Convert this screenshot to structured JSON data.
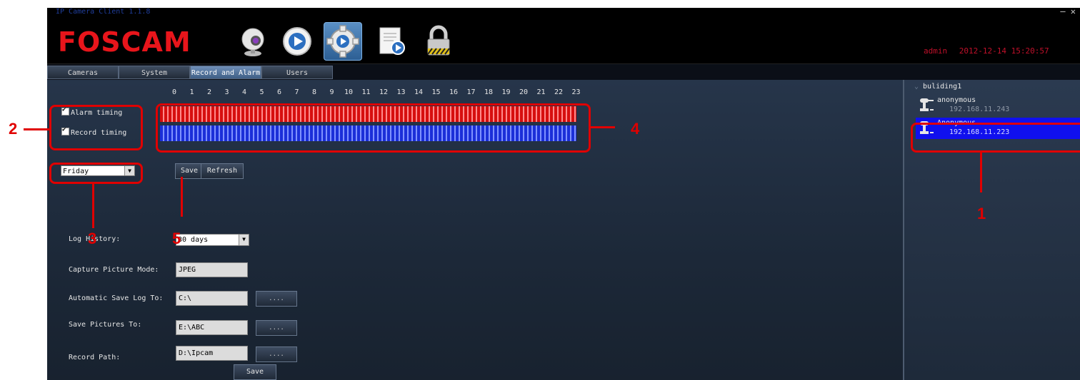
{
  "window": {
    "title": "IP Camera Client 1.1.8",
    "controls": "— ✕"
  },
  "header": {
    "logo": "FOSCAM",
    "user": "admin",
    "datetime": "2012-12-14  15:20:57"
  },
  "nav_icons": [
    "webcam-icon",
    "play-icon",
    "gear-icon",
    "log-document-icon",
    "lock-icon"
  ],
  "tabs": [
    "Cameras",
    "System",
    "Record and Alarm",
    "Users"
  ],
  "active_tab": "Record and Alarm",
  "schedule": {
    "hours": [
      "0",
      "1",
      "2",
      "3",
      "4",
      "5",
      "6",
      "7",
      "8",
      "9",
      "10",
      "11",
      "12",
      "13",
      "14",
      "15",
      "16",
      "17",
      "18",
      "19",
      "20",
      "21",
      "22",
      "23"
    ],
    "alarm_label": "Alarm timing",
    "record_label": "Record timing",
    "alarm_checked": true,
    "record_checked": true,
    "alarm_color": "#d60e0e",
    "record_color": "#1b2fd8",
    "day": "Friday",
    "save": "Save",
    "refresh": "Refresh"
  },
  "settings": {
    "log_history_label": "Log History:",
    "log_history_value": "30 days",
    "capture_mode_label": "Capture Picture Mode:",
    "capture_mode_value": "JPEG",
    "save_log_label": "Automatic Save Log To:",
    "save_log_value": "C:\\",
    "save_pictures_label": "Save Pictures To:",
    "save_pictures_value": "E:\\ABC",
    "record_path_label": "Record Path:",
    "record_path_value": "D:\\Ipcam",
    "browse": "....",
    "save": "Save"
  },
  "sidebar": {
    "group": "buliding1",
    "cameras": [
      {
        "name": "anonymous",
        "ip": "192.168.11.243"
      },
      {
        "name": "Anonymous",
        "ip": "192.168.11.223"
      }
    ],
    "selected_color": "#1010ee"
  },
  "annotations": [
    "1",
    "2",
    "3",
    "4",
    "5"
  ]
}
